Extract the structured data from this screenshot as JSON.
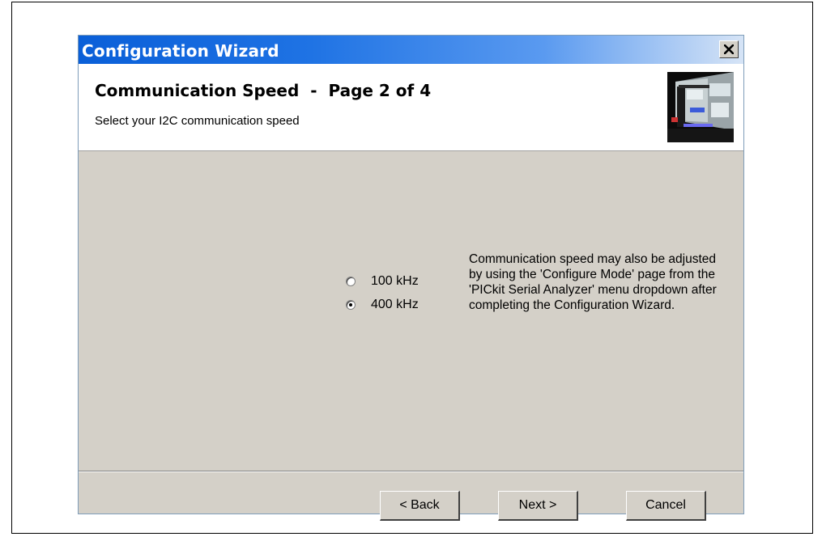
{
  "window": {
    "title": "Configuration Wizard",
    "close_glyph": "✕"
  },
  "header": {
    "title": "Communication Speed  -  Page 2 of 4",
    "subtitle": "Select your I2C communication speed"
  },
  "speed_options": [
    {
      "label": "100 kHz",
      "selected": false
    },
    {
      "label": "400 kHz",
      "selected": true
    }
  ],
  "note": "Communication speed may also be adjusted by using the 'Configure Mode' page from the 'PICkit Serial Analyzer' menu dropdown after completing the Configuration Wizard.",
  "buttons": {
    "back": "< Back",
    "next": "Next >",
    "cancel": "Cancel"
  },
  "colors": {
    "titlebar_start": "#0a5fd8",
    "titlebar_end": "#d6e4f6",
    "dialog_face": "#d4d0c8"
  }
}
